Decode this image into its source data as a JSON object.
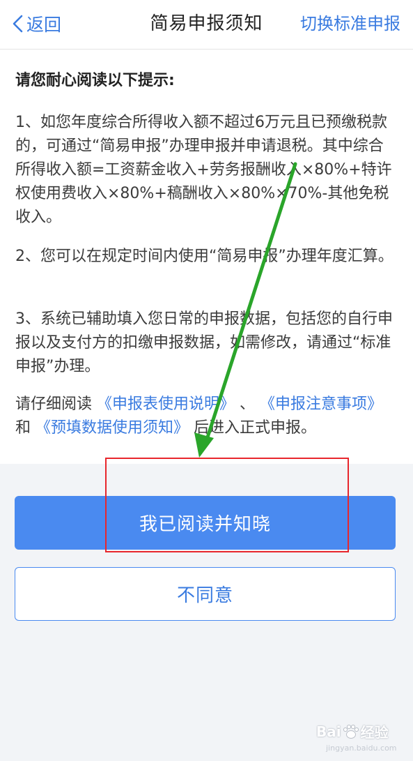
{
  "navbar": {
    "back_label": "返回",
    "title": "简易申报须知",
    "right_action": "切换标准申报"
  },
  "notice": {
    "heading": "请您耐心阅读以下提示:",
    "item1": "1、如您年度综合所得收入额不超过6万元且已预缴税款的，可通过“简易申报”办理申报并申请退税。其中综合所得收入额=工资薪金收入+劳务报酬收入×80%+特许权使用费收入×80%+稿酬收入×80%×70%-其他免税收入。",
    "item2": "2、您可以在规定时间内使用“简易申报”办理年度汇算。",
    "item3": "3、系统已辅助填入您日常的申报数据，包括您的自行申报以及支付方的扣缴申报数据，如需修改，请通过“标准申报”办理。",
    "read_prefix": "请仔细阅读",
    "link1": "《申报表使用说明》",
    "sep1": "、",
    "link2": "《申报注意事项》",
    "sep2": "和",
    "link3": "《预填数据使用须知》",
    "read_suffix": "后进入正式申报。"
  },
  "buttons": {
    "confirm": "我已阅读并知晓",
    "decline": "不同意"
  },
  "watermark": {
    "brand_left": "Bai",
    "brand_right": "经验",
    "url": "jingyan.baidu.com"
  },
  "colors": {
    "accent": "#4a8af0",
    "link": "#3a7be0",
    "annotation_arrow": "#2aa52a",
    "annotation_box": "#e8262c"
  }
}
